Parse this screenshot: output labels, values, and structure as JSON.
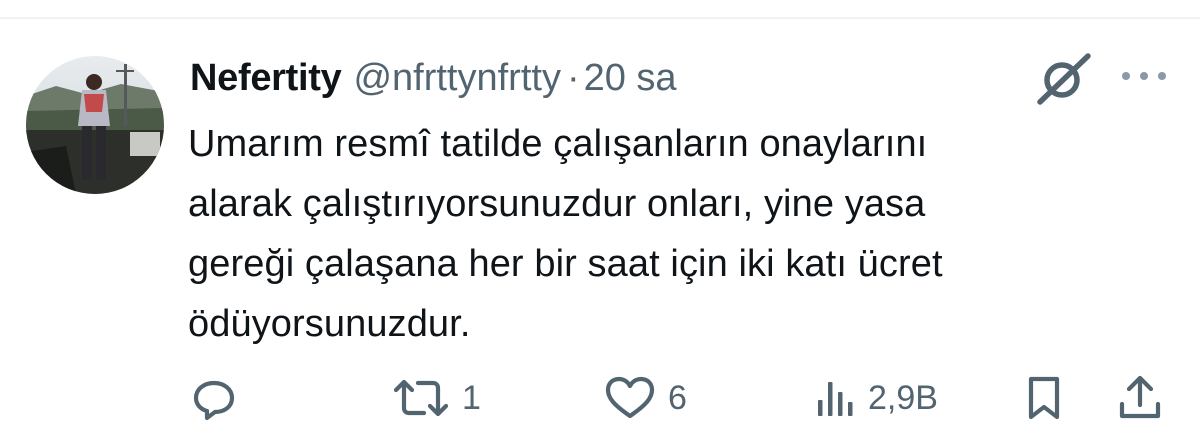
{
  "tweet": {
    "author_name": "Nefertity",
    "author_handle": "@nfrttynfrtty",
    "separator": "·",
    "time": "20 sa",
    "text": "Umarım resmî tatilde çalışanların onaylarını\nalarak çalıştırıyorsunuzdur onları, yine yasa\ngereği çalaşana her bir saat için iki katı ücret\nödüyorsunuzdur."
  },
  "actions": {
    "reply": {
      "icon": "reply-icon",
      "count": ""
    },
    "retweet": {
      "icon": "retweet-icon",
      "count": "1"
    },
    "like": {
      "icon": "heart-icon",
      "count": "6"
    },
    "views": {
      "icon": "views-icon",
      "count": "2,9B"
    },
    "bookmark": {
      "icon": "bookmark-icon"
    },
    "share": {
      "icon": "share-icon"
    }
  },
  "colors": {
    "text_primary": "#0f1419",
    "text_secondary": "#536471",
    "divider": "#eff3f4"
  }
}
